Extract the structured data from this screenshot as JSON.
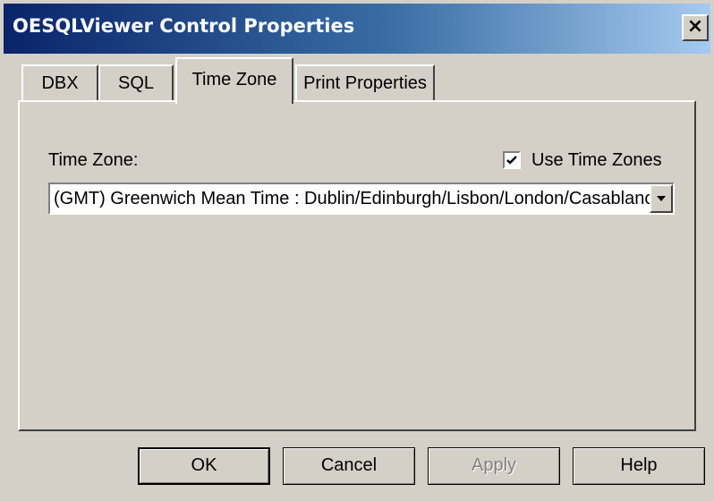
{
  "window": {
    "title": "OESQLViewer Control Properties",
    "close_glyph": "×",
    "titlebar_colors": [
      "#0a246a",
      "#a6caf0"
    ]
  },
  "tabs": [
    {
      "label": "DBX",
      "active": false
    },
    {
      "label": "SQL",
      "active": false
    },
    {
      "label": "Time Zone",
      "active": true
    },
    {
      "label": "Print Properties",
      "active": false
    }
  ],
  "timezone_panel": {
    "label": "Time Zone:",
    "use_time_zones": {
      "label": "Use Time Zones",
      "checked": true
    },
    "select": {
      "value": "(GMT) Greenwich Mean Time : Dublin/Edinburgh/Lisbon/London/Casablanca"
    }
  },
  "buttons": {
    "ok": "OK",
    "cancel": "Cancel",
    "apply": "Apply",
    "help": "Help"
  }
}
